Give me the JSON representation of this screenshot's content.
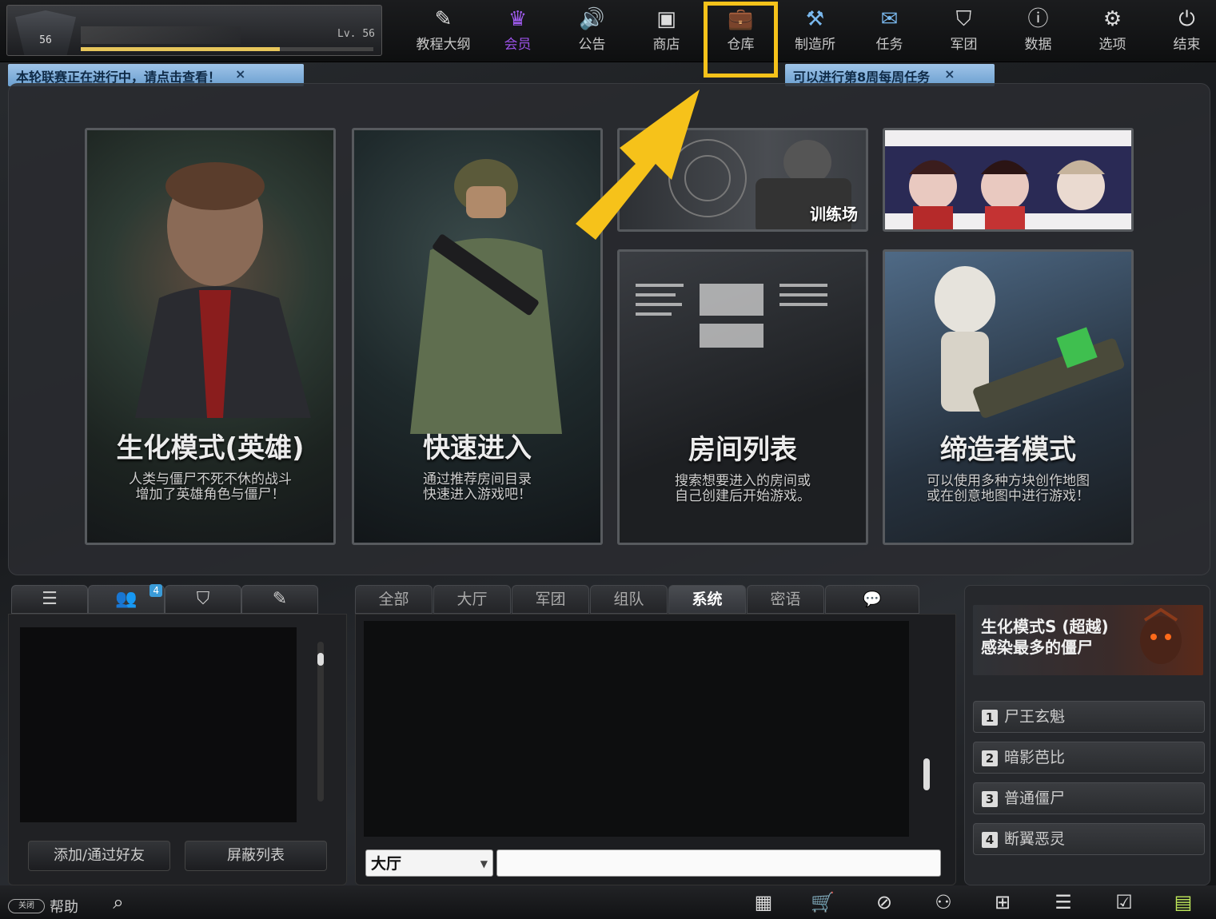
{
  "profile": {
    "rank_num": "56",
    "level": "Lv. 56",
    "xp_fraction": 0.68
  },
  "nav": [
    {
      "label": "教程大纲",
      "icon": "✎"
    },
    {
      "label": "会员",
      "icon": "♛"
    },
    {
      "label": "公告",
      "icon": "🔊"
    },
    {
      "label": "商店",
      "icon": "▣"
    },
    {
      "label": "仓库",
      "icon": "💼"
    },
    {
      "label": "制造所",
      "icon": "⚒"
    },
    {
      "label": "任务",
      "icon": "✉"
    },
    {
      "label": "军团",
      "icon": "⛉"
    },
    {
      "label": "数据",
      "icon": "ⓘ"
    },
    {
      "label": "选项",
      "icon": "⚙"
    },
    {
      "label": "结束",
      "icon": "⏻"
    }
  ],
  "notices": [
    {
      "text": "本轮联赛正在进行中，请点击查看！",
      "close": "×"
    },
    {
      "text": "可以进行第8周每周任务",
      "close": "×"
    }
  ],
  "cards": [
    {
      "title": "生化模式(英雄)",
      "desc": "人类与僵尸不死不休的战斗\n增加了英雄角色与僵尸！"
    },
    {
      "title": "快速进入",
      "desc": "通过推荐房间目录\n快速进入游戏吧！"
    },
    {
      "title": "房间列表",
      "desc": "搜索想要进入的房间或\n自己创建后开始游戏。"
    },
    {
      "title": "缔造者模式",
      "desc": "可以使用多种方块创作地图\n或在创意地图中进行游戏！"
    }
  ],
  "training_label": "训练场",
  "friend_tabs": {
    "badge": "4"
  },
  "friend_buttons": {
    "add": "添加/通过好友",
    "block": "屏蔽列表"
  },
  "chat_tabs": [
    "全部",
    "大厅",
    "军团",
    "组队",
    "系统",
    "密语",
    "💬"
  ],
  "chat_active": "系统",
  "chat_channel": "大厅",
  "ranking": {
    "banner": "生化模式S (超越)\n感染最多的僵尸",
    "rows": [
      {
        "num": "1",
        "name": "尸王玄魁"
      },
      {
        "num": "2",
        "name": "暗影芭比"
      },
      {
        "num": "3",
        "name": "普通僵尸"
      },
      {
        "num": "4",
        "name": "断翼恶灵"
      }
    ]
  },
  "bottom": {
    "help": "帮助",
    "toggle": "关闭"
  },
  "colors": {
    "highlight": "#f6c21a",
    "vip": "#9a51e6",
    "notice": "#9fc4e8"
  }
}
